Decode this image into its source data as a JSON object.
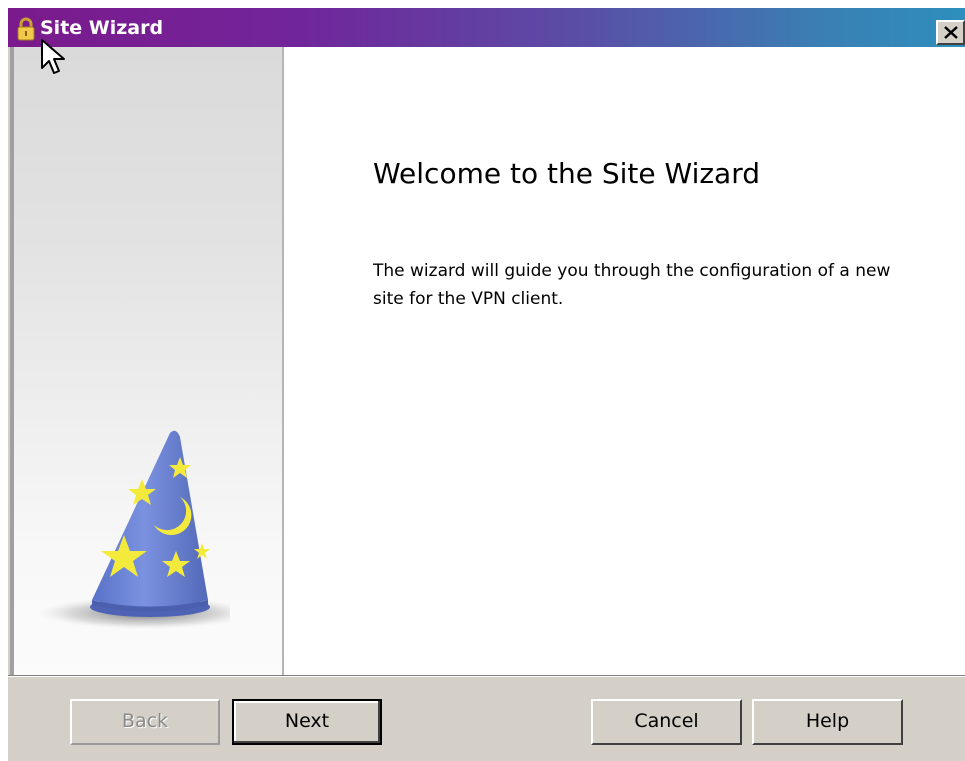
{
  "window": {
    "title": "Site Wizard",
    "title_icon": "lock-icon",
    "close_icon": "close-icon"
  },
  "side_panel": {
    "illustration": "wizard-hat-icon"
  },
  "content": {
    "heading": "Welcome to the Site Wizard",
    "description": "The wizard will guide you through the configuration of a new site for the VPN client."
  },
  "buttons": {
    "back": "Back",
    "next": "Next",
    "cancel": "Cancel",
    "help": "Help"
  },
  "colors": {
    "titlebar_start": "#7b1a8c",
    "titlebar_end": "#2d8fbd",
    "hat_blue": "#6f86d8",
    "star_yellow": "#f4ea3c"
  }
}
